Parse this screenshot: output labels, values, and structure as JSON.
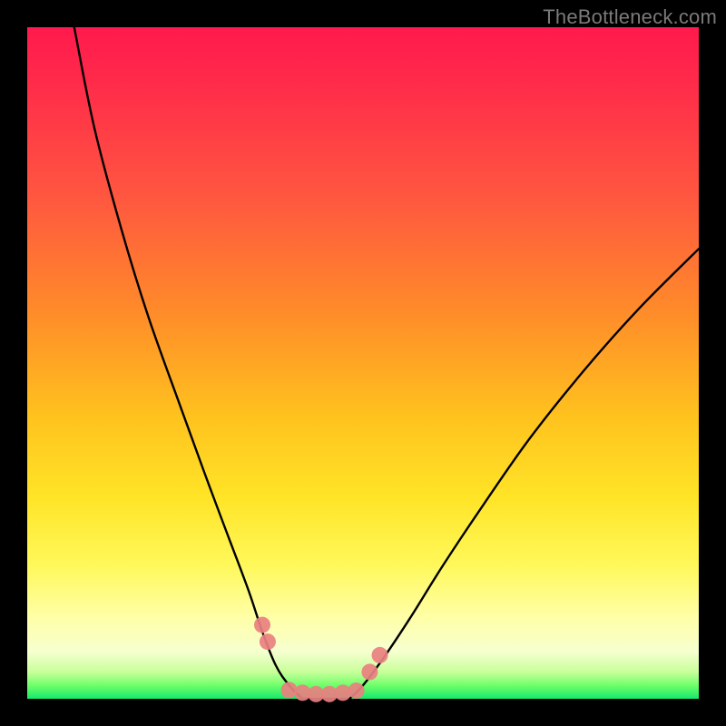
{
  "watermark": "TheBottleneck.com",
  "chart_data": {
    "type": "line",
    "title": "",
    "xlabel": "",
    "ylabel": "",
    "xlim": [
      0,
      100
    ],
    "ylim": [
      0,
      100
    ],
    "grid": false,
    "legend": false,
    "gradient_stops": [
      {
        "pct": 0,
        "color": "#ff1a4d"
      },
      {
        "pct": 8,
        "color": "#ff2a4a"
      },
      {
        "pct": 25,
        "color": "#ff5640"
      },
      {
        "pct": 42,
        "color": "#ff8a2a"
      },
      {
        "pct": 58,
        "color": "#ffc21e"
      },
      {
        "pct": 70,
        "color": "#ffe427"
      },
      {
        "pct": 80,
        "color": "#fff85a"
      },
      {
        "pct": 88,
        "color": "#ffffa8"
      },
      {
        "pct": 93,
        "color": "#f6ffd0"
      },
      {
        "pct": 96,
        "color": "#c8ff9a"
      },
      {
        "pct": 98,
        "color": "#6fff6a"
      },
      {
        "pct": 100,
        "color": "#17e86b"
      }
    ],
    "series": [
      {
        "name": "left-curve",
        "stroke": "#000000",
        "points": [
          {
            "x": 7,
            "y": 100
          },
          {
            "x": 10,
            "y": 85
          },
          {
            "x": 14,
            "y": 70
          },
          {
            "x": 18,
            "y": 57
          },
          {
            "x": 23,
            "y": 43
          },
          {
            "x": 27,
            "y": 32
          },
          {
            "x": 30,
            "y": 24
          },
          {
            "x": 33,
            "y": 16
          },
          {
            "x": 35,
            "y": 10
          },
          {
            "x": 37,
            "y": 5
          },
          {
            "x": 39,
            "y": 2
          },
          {
            "x": 41,
            "y": 0
          }
        ]
      },
      {
        "name": "right-curve",
        "stroke": "#000000",
        "points": [
          {
            "x": 48,
            "y": 0
          },
          {
            "x": 50,
            "y": 2
          },
          {
            "x": 53,
            "y": 6
          },
          {
            "x": 57,
            "y": 12
          },
          {
            "x": 62,
            "y": 20
          },
          {
            "x": 68,
            "y": 29
          },
          {
            "x": 75,
            "y": 39
          },
          {
            "x": 83,
            "y": 49
          },
          {
            "x": 91,
            "y": 58
          },
          {
            "x": 100,
            "y": 67
          }
        ]
      },
      {
        "name": "bottom-flat",
        "stroke": "#000000",
        "points": [
          {
            "x": 41,
            "y": 0
          },
          {
            "x": 48,
            "y": 0
          }
        ]
      }
    ],
    "markers": {
      "color": "#e98080",
      "clusters": [
        {
          "name": "left-arm",
          "points": [
            {
              "x": 35,
              "y": 11
            },
            {
              "x": 35.8,
              "y": 8.5
            }
          ]
        },
        {
          "name": "right-arm",
          "points": [
            {
              "x": 51,
              "y": 4
            },
            {
              "x": 52.5,
              "y": 6.5
            }
          ]
        },
        {
          "name": "valley",
          "points": [
            {
              "x": 39,
              "y": 1.3
            },
            {
              "x": 41,
              "y": 0.9
            },
            {
              "x": 43,
              "y": 0.7
            },
            {
              "x": 45,
              "y": 0.7
            },
            {
              "x": 47,
              "y": 0.9
            },
            {
              "x": 49,
              "y": 1.2
            }
          ]
        }
      ]
    }
  }
}
